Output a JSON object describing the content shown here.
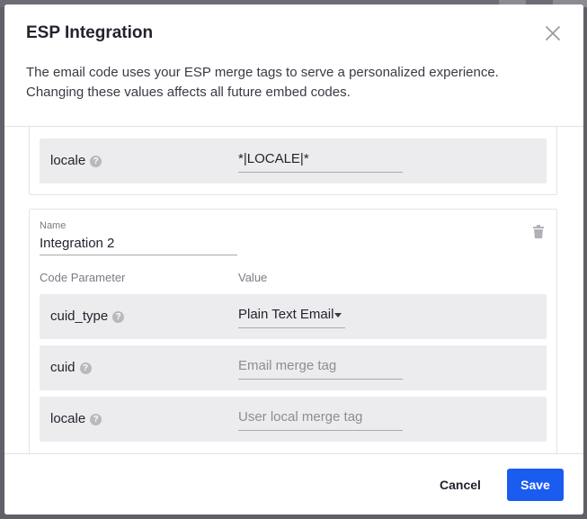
{
  "modal": {
    "title": "ESP Integration",
    "description": "The email code uses your ESP merge tags to serve a personalized experience. Changing these values affects all future embed codes."
  },
  "integration_1": {
    "params": [
      {
        "name": "locale",
        "value": "*|LOCALE|*",
        "has_help": true
      }
    ]
  },
  "integration_2": {
    "name_label": "Name",
    "name_value": "Integration 2",
    "columns": {
      "param": "Code Parameter",
      "value": "Value"
    },
    "params": [
      {
        "name": "cuid_type",
        "value": "Plain Text Email",
        "type": "select",
        "has_help": true
      },
      {
        "name": "cuid",
        "placeholder": "Email merge tag",
        "value": "",
        "has_help": true
      },
      {
        "name": "locale",
        "placeholder": "User local merge tag",
        "value": "",
        "has_help": true
      }
    ]
  },
  "help_glyph": "?",
  "footer": {
    "cancel_label": "Cancel",
    "save_label": "Save"
  },
  "colors": {
    "primary": "#1a5cf0",
    "row_bg": "#ececee",
    "text": "#23232f"
  },
  "icons": [
    "close-icon",
    "help-icon",
    "trash-icon",
    "caret-down-icon"
  ]
}
